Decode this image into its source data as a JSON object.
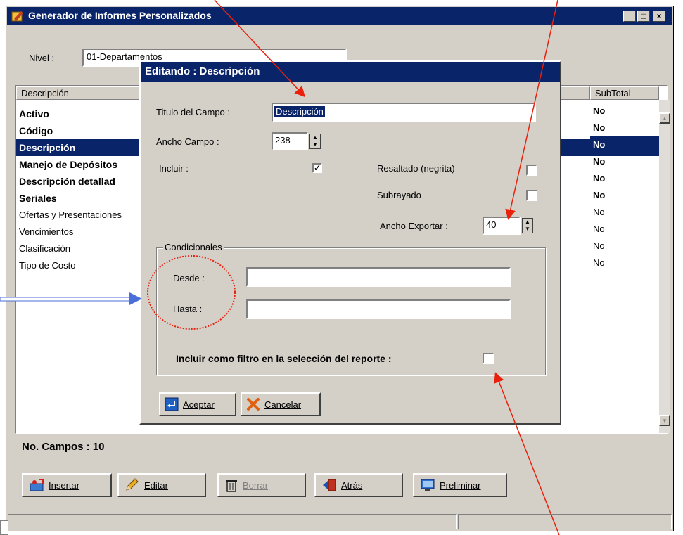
{
  "window": {
    "title": "Generador de Informes Personalizados",
    "min": "_",
    "max": "□",
    "close": "×"
  },
  "nivel": {
    "label": "Nivel :",
    "value": "01-Departamentos"
  },
  "list": {
    "col_desc": "Descripción",
    "col_subtotal": "SubTotal",
    "rows": [
      {
        "desc": "Activo",
        "subtotal": "No"
      },
      {
        "desc": "Código",
        "subtotal": "No"
      },
      {
        "desc": "Descripción",
        "subtotal": "No"
      },
      {
        "desc": "Manejo de Depósitos",
        "subtotal": "No"
      },
      {
        "desc": "Descripción detallad",
        "subtotal": "No"
      },
      {
        "desc": "Seriales",
        "subtotal": "No"
      },
      {
        "desc": "Ofertas y Presentaciones",
        "subtotal": "No"
      },
      {
        "desc": "Vencimientos",
        "subtotal": "No"
      },
      {
        "desc": "Clasificación",
        "subtotal": "No"
      },
      {
        "desc": "Tipo de Costo",
        "subtotal": "No"
      }
    ]
  },
  "campos": "No. Campos : 10",
  "buttons": {
    "insertar": "Insertar",
    "editar": "Editar",
    "borrar": "Borrar",
    "atras": "Atrás",
    "preliminar": "Preliminar"
  },
  "dialog": {
    "title": "Editando : Descripción",
    "titulo_label": "Titulo del Campo :",
    "titulo_value": "Descripción",
    "ancho_label": "Ancho Campo :",
    "ancho_value": "238",
    "incluir_label": "Incluir :",
    "resaltado_label": "Resaltado (negrita)",
    "subrayado_label": "Subrayado",
    "exportar_label": "Ancho Exportar :",
    "exportar_value": "40",
    "condicionales_label": "Condicionales",
    "desde_label": "Desde :",
    "hasta_label": "Hasta :",
    "filtro_label": "Incluir como filtro en la selección del reporte  :",
    "aceptar": "Aceptar",
    "cancelar": "Cancelar"
  },
  "colors": {
    "titlebar": "#0a246a",
    "face": "#d4d0c8",
    "annotation": "#e8200c",
    "arrow_blue": "#4a6fd8"
  }
}
